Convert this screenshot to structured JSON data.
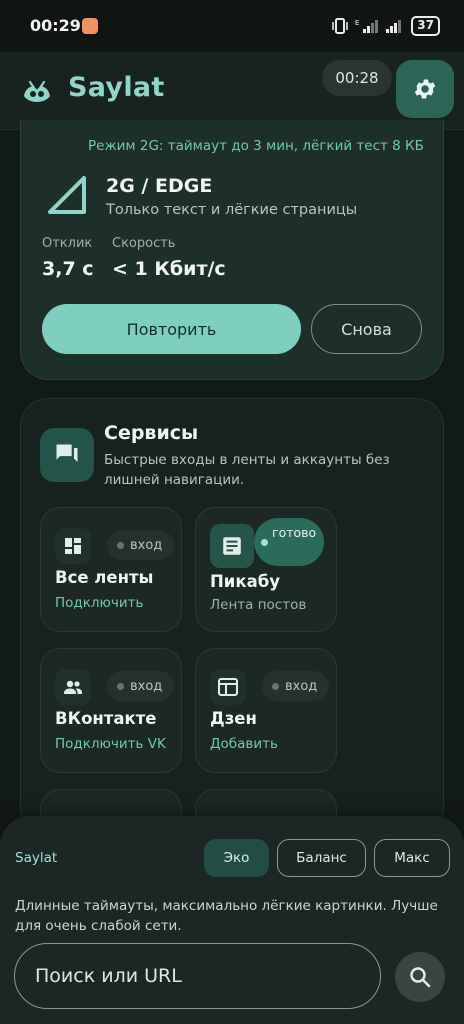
{
  "status_bar": {
    "time": "00:29",
    "battery": "37"
  },
  "app": {
    "title": "Saylat",
    "timer": "00:28"
  },
  "network": {
    "mode_text": "Режим 2G: таймаут до 3 мин, лёгкий тест 8 КБ",
    "type": "2G / EDGE",
    "description": "Только текст и лёгкие страницы",
    "latency_label": "Отклик",
    "latency_value": "3,7 с",
    "speed_label": "Скорость",
    "speed_value": "< 1 Кбит/с",
    "retry_label": "Повторить",
    "again_label": "Снова"
  },
  "services": {
    "title": "Сервисы",
    "description": "Быстрые входы в ленты и аккаунты без лишней навигации.",
    "tiles": [
      {
        "name": "Все ленты",
        "status": "вход",
        "link": "Подключить",
        "icon": "grid-icon"
      },
      {
        "name": "Пикабу",
        "status": "готово",
        "sub": "Лента постов",
        "icon": "article-icon"
      },
      {
        "name": "ВКонтакте",
        "status": "вход",
        "link": "Подключить VK",
        "icon": "people-icon"
      },
      {
        "name": "Дзен",
        "status": "вход",
        "link": "Добавить",
        "icon": "window-icon"
      }
    ]
  },
  "sheet": {
    "label": "Saylat",
    "modes": [
      "Эко",
      "Баланс",
      "Макс"
    ],
    "active_mode": "Эко",
    "description": "Длинные таймауты, максимально лёгкие картинки. Лучше для очень слабой сети.",
    "search_placeholder": "Поиск или URL"
  }
}
